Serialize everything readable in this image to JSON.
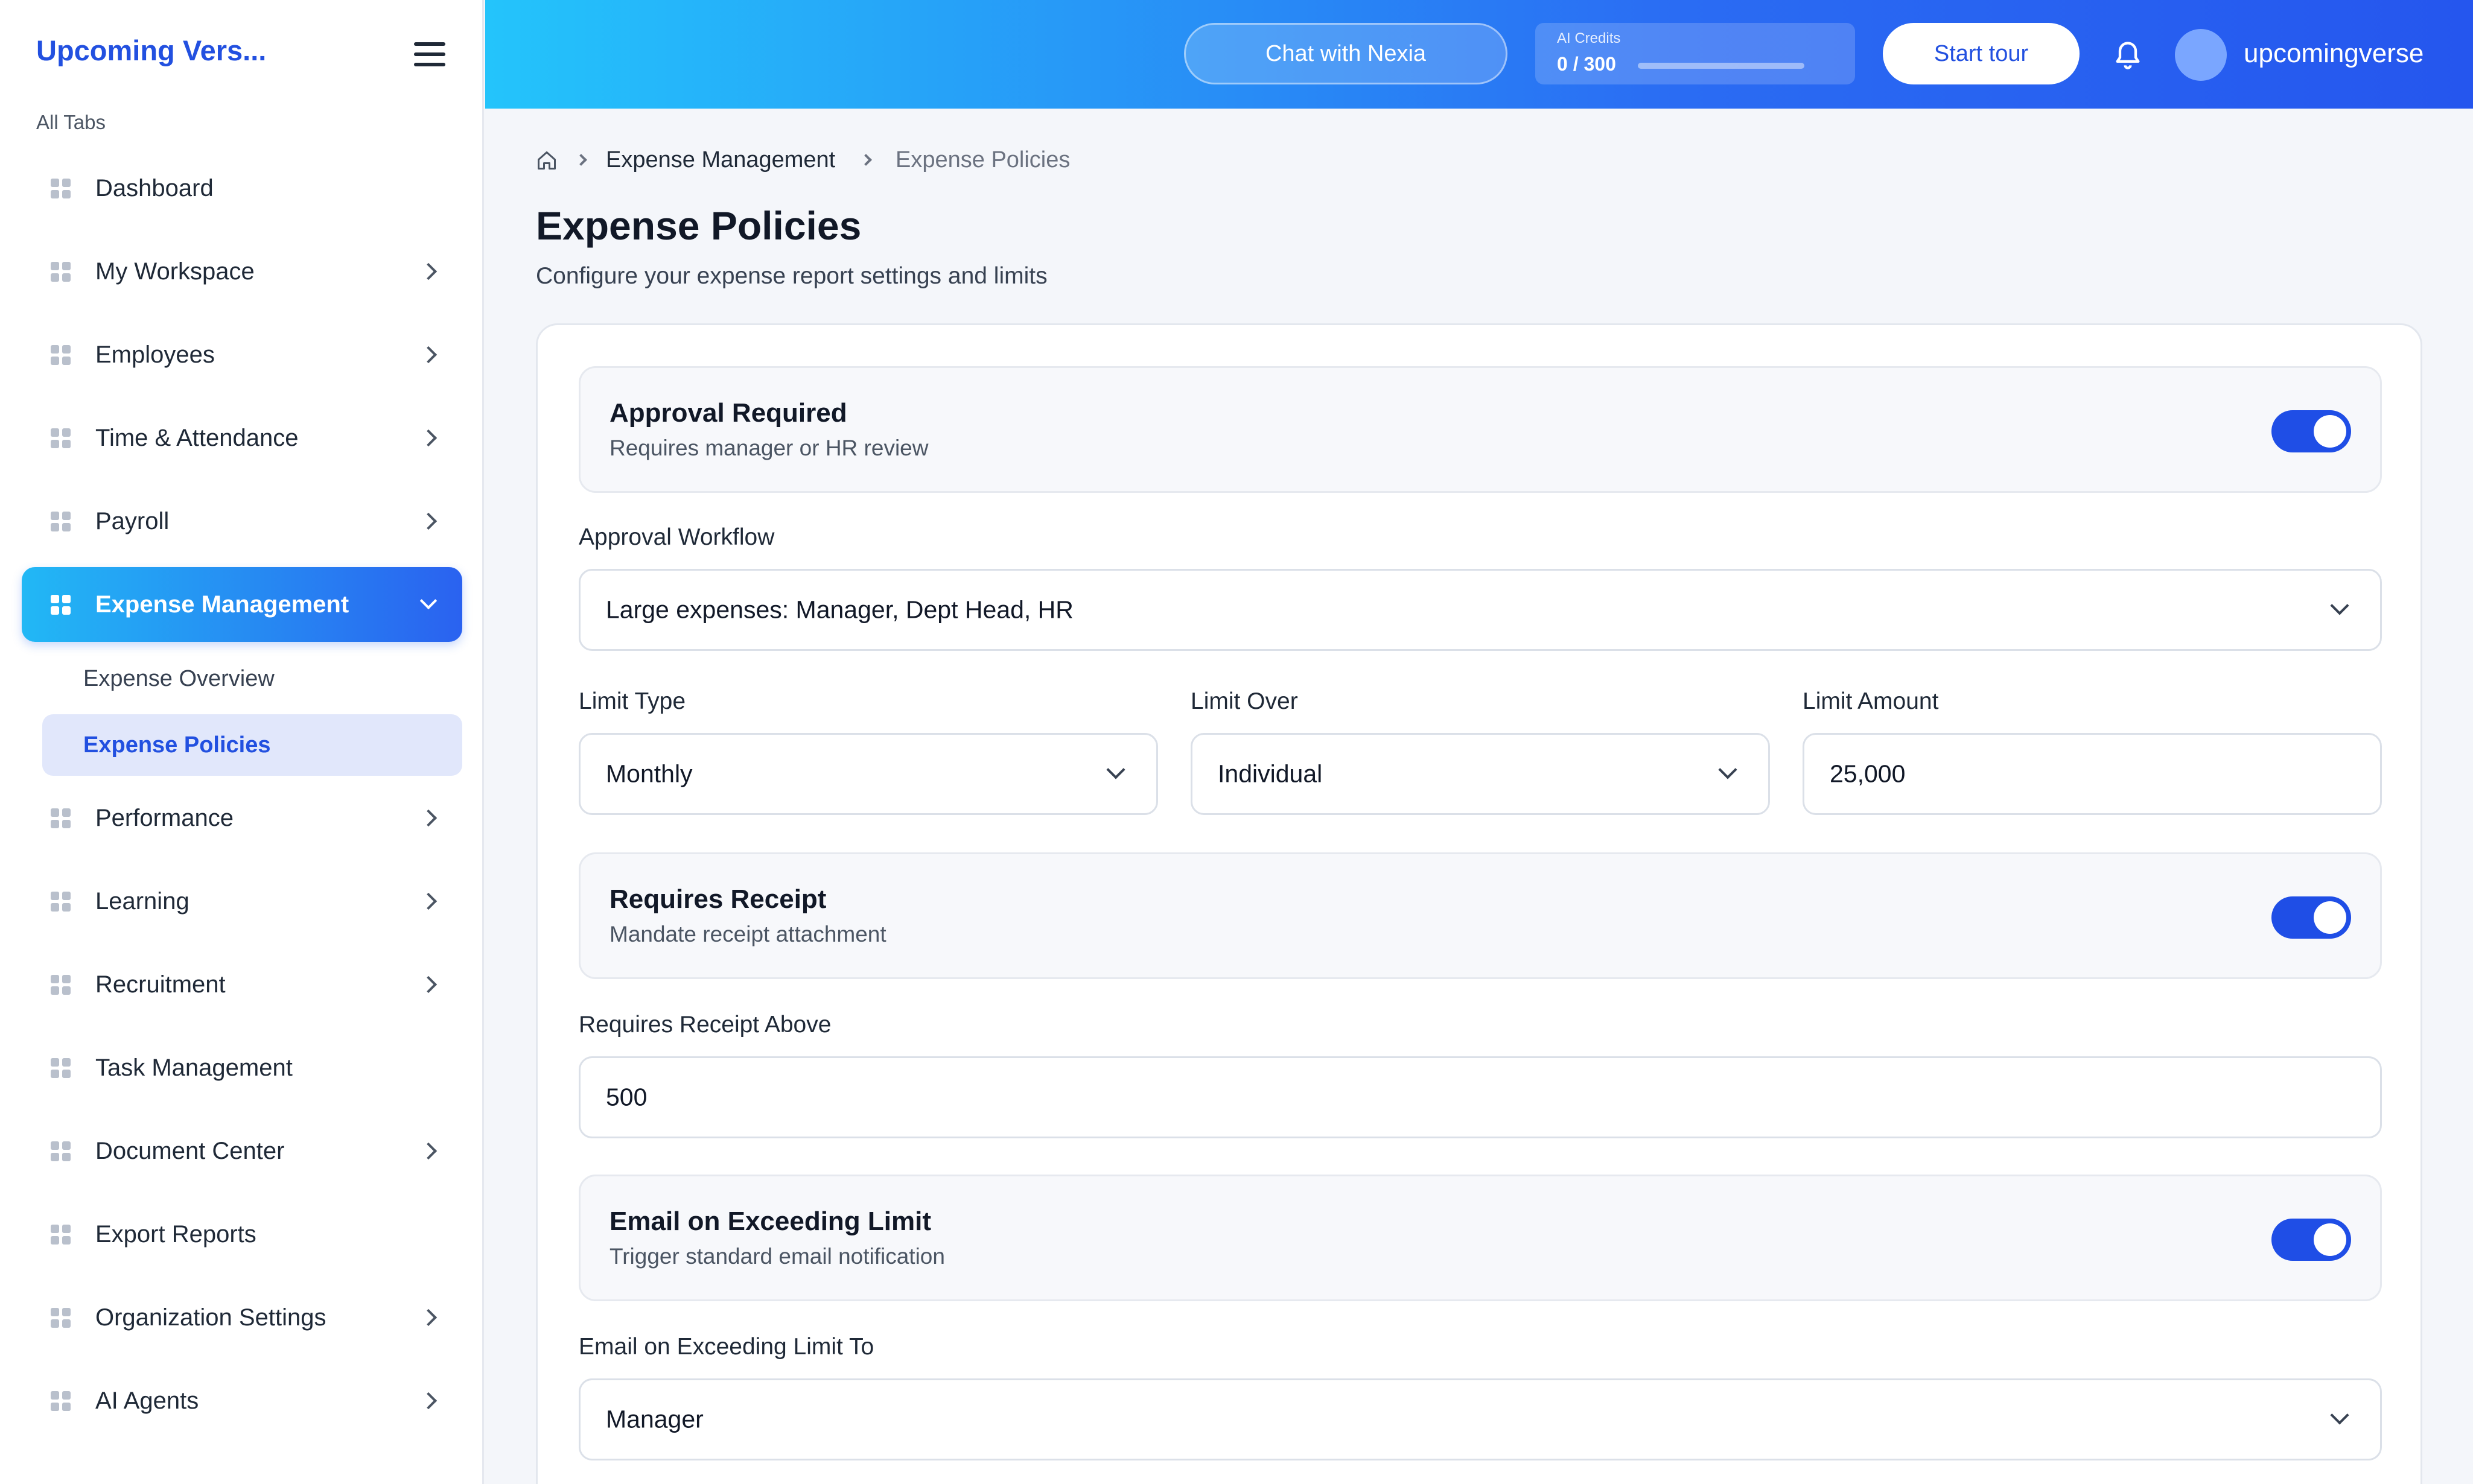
{
  "sidebar": {
    "brand": "Upcoming Vers...",
    "section_label": "All Tabs",
    "items": [
      {
        "label": "Dashboard"
      },
      {
        "label": "My Workspace"
      },
      {
        "label": "Employees"
      },
      {
        "label": "Time & Attendance"
      },
      {
        "label": "Payroll"
      },
      {
        "label": "Expense Management"
      },
      {
        "label": "Performance"
      },
      {
        "label": "Learning"
      },
      {
        "label": "Recruitment"
      },
      {
        "label": "Task Management"
      },
      {
        "label": "Document Center"
      },
      {
        "label": "Export Reports"
      },
      {
        "label": "Organization Settings"
      },
      {
        "label": "AI Agents"
      }
    ],
    "sub_items": [
      {
        "label": "Expense Overview"
      },
      {
        "label": "Expense Policies"
      }
    ]
  },
  "header": {
    "chat_button": "Chat with Nexia",
    "credits_label": "AI Credits",
    "credits_value": "0 / 300",
    "credits_fraction": 0,
    "tour_button": "Start tour",
    "username": "upcomingverse"
  },
  "breadcrumb": {
    "parent": "Expense Management",
    "current": "Expense Policies"
  },
  "page": {
    "title": "Expense Policies",
    "subtitle": "Configure your expense report settings and limits"
  },
  "form": {
    "approval": {
      "title": "Approval Required",
      "subtitle": "Requires manager or HR review",
      "enabled": true
    },
    "workflow": {
      "label": "Approval Workflow",
      "value": "Large expenses: Manager, Dept Head, HR"
    },
    "limit_type": {
      "label": "Limit Type",
      "value": "Monthly"
    },
    "limit_over": {
      "label": "Limit Over",
      "value": "Individual"
    },
    "limit_amount": {
      "label": "Limit Amount",
      "value": "25,000"
    },
    "receipt": {
      "title": "Requires Receipt",
      "subtitle": "Mandate receipt attachment",
      "enabled": true
    },
    "receipt_above": {
      "label": "Requires Receipt Above",
      "value": "500"
    },
    "email": {
      "title": "Email on Exceeding Limit",
      "subtitle": "Trigger standard email notification",
      "enabled": true
    },
    "email_to": {
      "label": "Email on Exceeding Limit To",
      "value": "Manager"
    }
  },
  "colors": {
    "brand": "#2250e0",
    "toggle_on": "#1f4ee6",
    "active_nav_start": "#22b8f5",
    "active_nav_end": "#2a62f0"
  }
}
